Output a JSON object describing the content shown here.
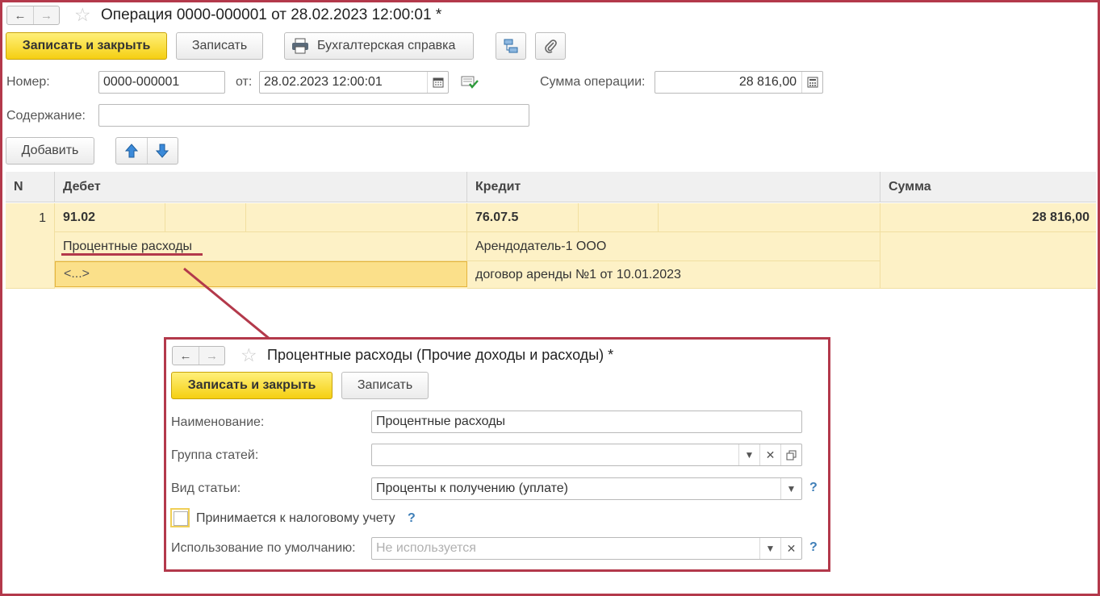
{
  "main": {
    "title": "Операция 0000-000001 от 28.02.2023 12:00:01 *",
    "nav_back": "←",
    "nav_forward": "→",
    "star": "☆",
    "toolbar": {
      "save_close": "Записать и закрыть",
      "save": "Записать",
      "report": "Бухгалтерская справка"
    },
    "number_label": "Номер:",
    "number_value": "0000-000001",
    "date_label": "от:",
    "date_value": "28.02.2023 12:00:01",
    "sum_label": "Сумма операции:",
    "sum_value": "28 816,00",
    "content_label": "Содержание:",
    "content_value": "",
    "add_button": "Добавить",
    "table": {
      "headers": [
        "N",
        "Дебет",
        "Кредит",
        "Сумма"
      ],
      "row": {
        "n": "1",
        "debit_account": "91.02",
        "credit_account": "76.07.5",
        "sum": "28 816,00",
        "debit_sub1": "Процентные расходы",
        "credit_sub1": "Арендодатель-1 ООО",
        "debit_sub2": "<...>",
        "credit_sub2": "договор аренды №1 от 10.01.2023"
      }
    }
  },
  "dialog": {
    "title": "Процентные расходы (Прочие доходы и расходы) *",
    "save_close": "Записать и закрыть",
    "save": "Записать",
    "name_label": "Наименование:",
    "name_value": "Процентные расходы",
    "group_label": "Группа статей:",
    "group_value": "",
    "kind_label": "Вид статьи:",
    "kind_value": "Проценты к получению (уплате)",
    "tax_label": "Принимается к налоговому учету",
    "default_label": "Использование по умолчанию:",
    "default_placeholder": "Не используется",
    "help": "?"
  },
  "colors": {
    "accent_frame": "#b3394b",
    "primary_button": "#f5cf12",
    "row_highlight": "#fdf1c6",
    "selected_cell": "#fbe08a",
    "help_blue": "#3f7fb8"
  },
  "icons": [
    "back-arrow-icon",
    "forward-arrow-icon",
    "favorite-star-icon",
    "printer-icon",
    "structure-icon",
    "attachment-icon",
    "calendar-icon",
    "posting-check-icon",
    "calculator-icon",
    "arrow-up-icon",
    "arrow-down-icon",
    "dropdown-icon",
    "clear-icon",
    "open-icon"
  ]
}
